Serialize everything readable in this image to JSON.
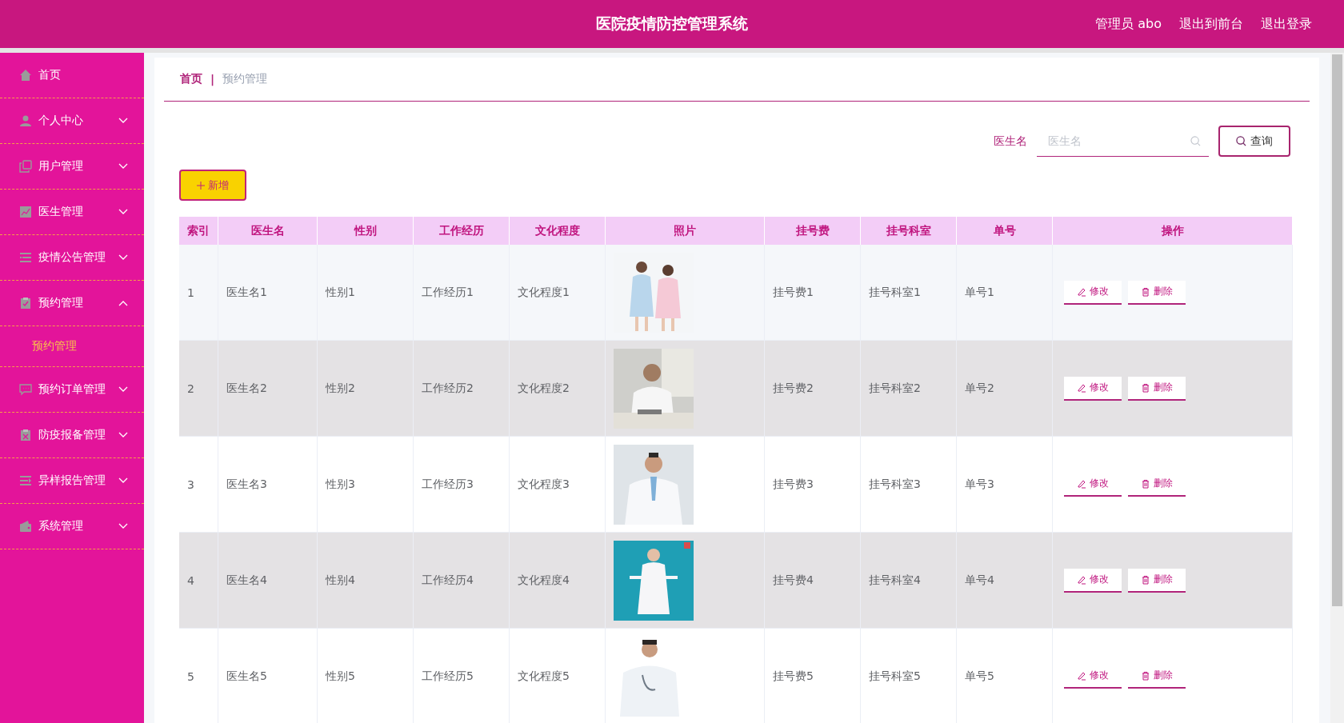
{
  "header": {
    "title": "医院疫情防控管理系统",
    "links": [
      "管理员 abo",
      "退出到前台",
      "退出登录"
    ]
  },
  "sidebar": {
    "items": [
      {
        "label": "首页",
        "kind": "link"
      },
      {
        "label": "个人中心",
        "kind": "menu",
        "expanded": false
      },
      {
        "label": "用户管理",
        "kind": "menu",
        "expanded": false
      },
      {
        "label": "医生管理",
        "kind": "menu",
        "expanded": false
      },
      {
        "label": "疫情公告管理",
        "kind": "menu",
        "expanded": false
      },
      {
        "label": "预约管理",
        "kind": "menu",
        "expanded": true,
        "children": [
          {
            "label": "预约管理",
            "selected": true
          }
        ]
      },
      {
        "label": "预约订单管理",
        "kind": "menu",
        "expanded": false
      },
      {
        "label": "防疫报备管理",
        "kind": "menu",
        "expanded": false
      },
      {
        "label": "异样报告管理",
        "kind": "menu",
        "expanded": false
      },
      {
        "label": "系统管理",
        "kind": "menu",
        "expanded": false
      }
    ]
  },
  "breadcrumb_separator": "|",
  "breadcrumb": [
    {
      "label": "首页",
      "current": false
    },
    {
      "label": "预约管理",
      "current": true
    }
  ],
  "search": {
    "label": "医生名",
    "placeholder": "医生名",
    "button": "查询"
  },
  "add_button": "新增",
  "table": {
    "columns": [
      "索引",
      "医生名",
      "性别",
      "工作经历",
      "文化程度",
      "照片",
      "挂号费",
      "挂号科室",
      "单号",
      "操作"
    ],
    "rows": [
      {
        "cells": [
          "1",
          "医生名1",
          "性别1",
          "工作经历1",
          "文化程度1",
          "",
          "挂号费1",
          "挂号科室1",
          "单号1"
        ],
        "photo": {
          "kind": "picture"
        },
        "actions": [
          "修改",
          "删除"
        ]
      },
      {
        "cells": [
          "2",
          "医生名2",
          "性别2",
          "工作经历2",
          "文化程度2",
          "",
          "挂号费2",
          "挂号科室2",
          "单号2"
        ],
        "photo": {
          "kind": "picture"
        },
        "actions": [
          "修改",
          "删除"
        ]
      },
      {
        "cells": [
          "3",
          "医生名3",
          "性别3",
          "工作经历3",
          "文化程度3",
          "",
          "挂号费3",
          "挂号科室3",
          "单号3"
        ],
        "photo": {
          "kind": "picture"
        },
        "actions": [
          "修改",
          "删除"
        ]
      },
      {
        "cells": [
          "4",
          "医生名4",
          "性别4",
          "工作经历4",
          "文化程度4",
          "",
          "挂号费4",
          "挂号科室4",
          "单号4"
        ],
        "photo": {
          "kind": "picture"
        },
        "actions": [
          "修改",
          "删除"
        ]
      },
      {
        "cells": [
          "5",
          "医生名5",
          "性别5",
          "工作经历5",
          "文化程度5",
          "",
          "挂号费5",
          "挂号科室5",
          "单号5"
        ],
        "photo": {
          "kind": "picture"
        },
        "actions": [
          "修改",
          "删除"
        ]
      }
    ]
  }
}
